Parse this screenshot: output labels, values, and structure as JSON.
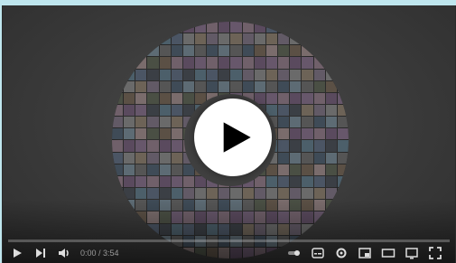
{
  "player": {
    "time_display": "0:00 / 3:54",
    "progress_fraction": 0.0,
    "colors": {
      "progress": "#cc1d1d",
      "play_button_bg": "#ffffff",
      "play_icon": "#000000",
      "page_bg": "#bfe6ee",
      "player_bg": "#3a3a3a"
    },
    "controls_left": [
      {
        "icon": "play-icon"
      },
      {
        "icon": "next-icon"
      },
      {
        "icon": "volume-icon"
      }
    ],
    "controls_right": [
      {
        "icon": "autoplay-toggle-icon"
      },
      {
        "icon": "subtitles-icon"
      },
      {
        "icon": "settings-gear-icon"
      },
      {
        "icon": "miniplayer-icon"
      },
      {
        "icon": "theater-mode-icon"
      },
      {
        "icon": "cast-icon"
      },
      {
        "icon": "fullscreen-icon"
      }
    ]
  }
}
